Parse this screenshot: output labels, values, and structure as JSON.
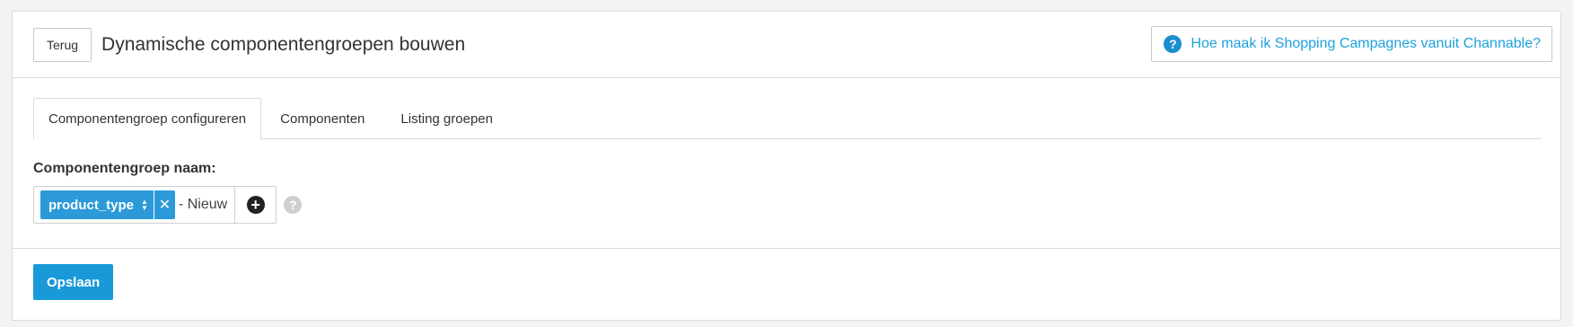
{
  "header": {
    "back_label": "Terug",
    "title": "Dynamische componentengroepen bouwen",
    "help_label": "Hoe maak ik Shopping Campagnes vanuit Channable?"
  },
  "tabs": [
    {
      "label": "Componentengroep configureren",
      "active": true
    },
    {
      "label": "Componenten",
      "active": false
    },
    {
      "label": "Listing groepen",
      "active": false
    }
  ],
  "form": {
    "group_name_label": "Componentengroep naam:",
    "tag": {
      "label": "product_type"
    },
    "suffix": "- Nieuw"
  },
  "footer": {
    "save_label": "Opslaan"
  },
  "colors": {
    "accent": "#1a99d9",
    "link": "#1ca1dc",
    "tag": "#2c9ad8"
  },
  "icons": {
    "help": "question-circle-icon",
    "sort": "sort-icon",
    "remove": "close-icon",
    "add": "plus-circle-icon",
    "hint": "question-circle-icon"
  }
}
